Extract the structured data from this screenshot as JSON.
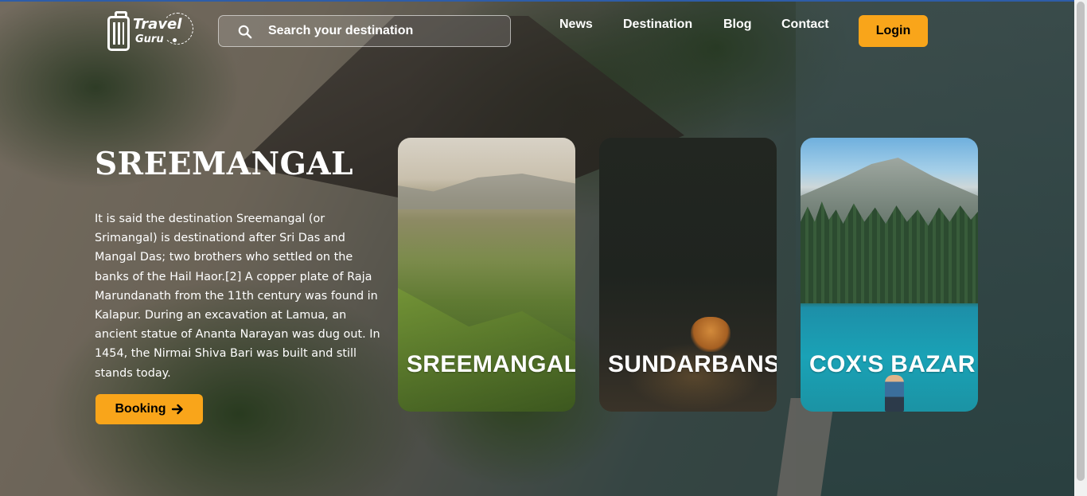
{
  "header": {
    "logo": {
      "line1": "Travel",
      "line2": "Guru"
    },
    "search": {
      "placeholder": "Search your destination"
    },
    "nav": [
      "News",
      "Destination",
      "Blog",
      "Contact"
    ],
    "login_label": "Login"
  },
  "hero": {
    "title": "SREEMANGAL",
    "description": "It is said the destination Sreemangal (or Srimangal) is destinationd after Sri Das and Mangal Das; two brothers who settled on the banks of the Hail Haor.[2] A copper plate of Raja Marundanath from the 11th century was found in Kalapur. During an excavation at Lamua, an ancient statue of Ananta Narayan was dug out. In 1454, the Nirmai Shiva Bari was built and still stands today.",
    "booking_label": "Booking",
    "booking_icon": "arrow-right-icon"
  },
  "cards": [
    {
      "label": "SREEMANGAL"
    },
    {
      "label": "SUNDARBANS"
    },
    {
      "label": "COX'S BAZAR"
    }
  ],
  "colors": {
    "accent": "#f9a51a",
    "text": "#ffffff"
  }
}
